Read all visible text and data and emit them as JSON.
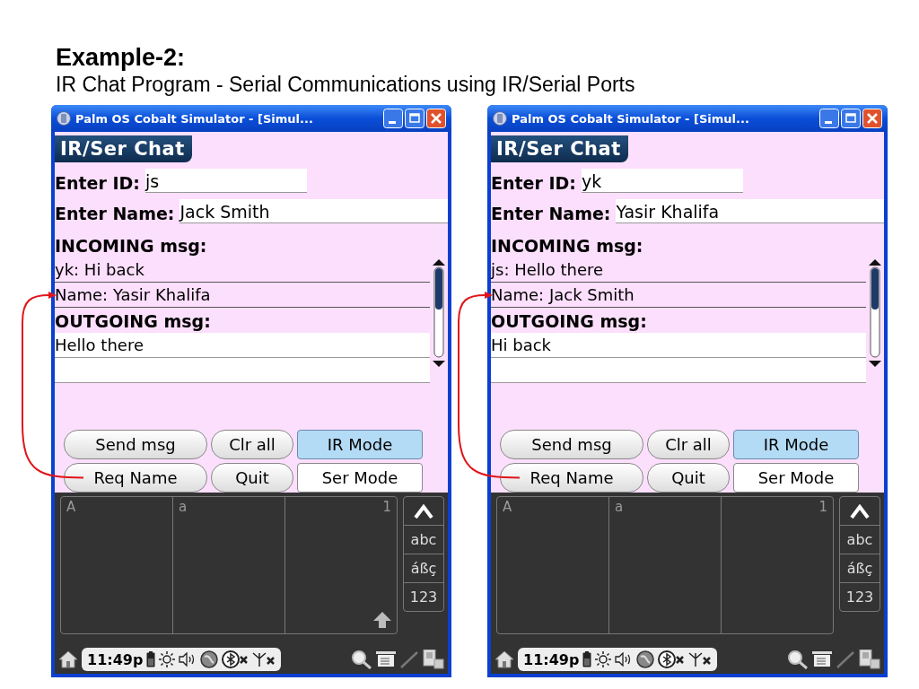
{
  "slide": {
    "heading": "Example-2:",
    "subheading": "IR Chat Program - Serial Communications using IR/Serial Ports"
  },
  "simulators": [
    {
      "window_title": "Palm OS Cobalt Simulator - [Simul...",
      "app_title": "IR/Ser Chat",
      "fields": [
        {
          "label": "Enter ID:",
          "value": "js"
        },
        {
          "label": "Enter Name:",
          "value": "Jack Smith"
        }
      ],
      "incoming": {
        "label": "INCOMING msg:",
        "lines": [
          "yk: Hi back",
          "Name: Yasir Khalifa"
        ]
      },
      "outgoing": {
        "label": "OUTGOING msg:",
        "lines": [
          "Hello there"
        ]
      },
      "buttons": [
        {
          "label": "Send msg",
          "kind": "push",
          "selected": false
        },
        {
          "label": "Clr all",
          "kind": "push",
          "selected": false
        },
        {
          "label": "IR Mode",
          "kind": "toggle",
          "selected": true
        },
        {
          "label": "Req Name",
          "kind": "push",
          "selected": false
        },
        {
          "label": "Quit",
          "kind": "push",
          "selected": false
        },
        {
          "label": "Ser Mode",
          "kind": "toggle",
          "selected": false
        }
      ],
      "annotation_arrow": true,
      "graffiti": {
        "panel_labels": [
          "A",
          "a",
          "1"
        ],
        "modes": [
          "abc",
          "áßç",
          "123"
        ],
        "shift_arrow": true
      },
      "status_bar": {
        "time": "11:49p"
      }
    },
    {
      "window_title": "Palm OS Cobalt Simulator - [Simul...",
      "app_title": "IR/Ser Chat",
      "fields": [
        {
          "label": "Enter ID:",
          "value": "yk"
        },
        {
          "label": "Enter Name:",
          "value": "Yasir Khalifa"
        }
      ],
      "incoming": {
        "label": "INCOMING msg:",
        "lines": [
          "js: Hello there",
          "Name: Jack Smith"
        ]
      },
      "outgoing": {
        "label": "OUTGOING msg:",
        "lines": [
          "Hi back"
        ]
      },
      "buttons": [
        {
          "label": "Send msg",
          "kind": "push",
          "selected": false
        },
        {
          "label": "Clr all",
          "kind": "push",
          "selected": false
        },
        {
          "label": "IR Mode",
          "kind": "toggle",
          "selected": true
        },
        {
          "label": "Req Name",
          "kind": "push",
          "selected": false
        },
        {
          "label": "Quit",
          "kind": "push",
          "selected": false
        },
        {
          "label": "Ser Mode",
          "kind": "toggle",
          "selected": false
        }
      ],
      "annotation_arrow": true,
      "graffiti": {
        "panel_labels": [
          "A",
          "a",
          "1"
        ],
        "modes": [
          "abc",
          "áßç",
          "123"
        ],
        "shift_arrow": false
      },
      "status_bar": {
        "time": "11:49p"
      }
    }
  ]
}
